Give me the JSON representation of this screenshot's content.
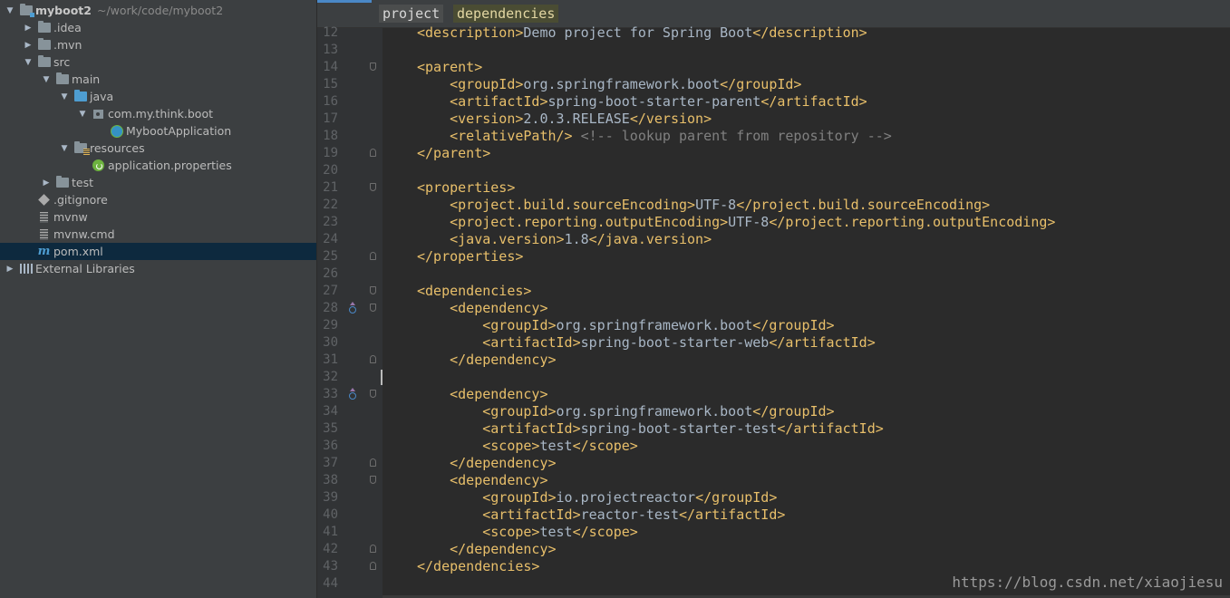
{
  "project": {
    "root": {
      "name": "myboot2",
      "path": "~/work/code/myboot2"
    },
    "tree": [
      {
        "label": "myboot2",
        "depth": 0,
        "arrow": "down",
        "icon": "module-folder",
        "bold": true
      },
      {
        "label": ".idea",
        "depth": 1,
        "arrow": "right",
        "icon": "folder"
      },
      {
        "label": ".mvn",
        "depth": 1,
        "arrow": "right",
        "icon": "folder"
      },
      {
        "label": "src",
        "depth": 1,
        "arrow": "down",
        "icon": "folder"
      },
      {
        "label": "main",
        "depth": 2,
        "arrow": "down",
        "icon": "folder"
      },
      {
        "label": "java",
        "depth": 3,
        "arrow": "down",
        "icon": "source-folder"
      },
      {
        "label": "com.my.think.boot",
        "depth": 4,
        "arrow": "down",
        "icon": "package"
      },
      {
        "label": "MybootApplication",
        "depth": 5,
        "arrow": "none",
        "icon": "spring-class"
      },
      {
        "label": "resources",
        "depth": 3,
        "arrow": "down",
        "icon": "resources-folder"
      },
      {
        "label": "application.properties",
        "depth": 4,
        "arrow": "none",
        "icon": "spring-properties"
      },
      {
        "label": "test",
        "depth": 2,
        "arrow": "right",
        "icon": "folder"
      },
      {
        "label": ".gitignore",
        "depth": 1,
        "arrow": "none",
        "icon": "git-file"
      },
      {
        "label": "mvnw",
        "depth": 1,
        "arrow": "none",
        "icon": "text-file"
      },
      {
        "label": "mvnw.cmd",
        "depth": 1,
        "arrow": "none",
        "icon": "text-file"
      },
      {
        "label": "pom.xml",
        "depth": 1,
        "arrow": "none",
        "icon": "maven-file",
        "selected": true
      },
      {
        "label": "External Libraries",
        "depth": 0,
        "arrow": "right",
        "icon": "libraries"
      }
    ]
  },
  "editor": {
    "breadcrumbs": [
      "project",
      "dependencies"
    ],
    "active_breadcrumb": 1,
    "lines": [
      {
        "n": "12",
        "text": "<description>Demo project for Spring Boot</description>"
      },
      {
        "n": "13",
        "text": ""
      },
      {
        "n": "14",
        "text": "<parent>",
        "fold": "open"
      },
      {
        "n": "15",
        "text": "    <groupId>org.springframework.boot</groupId>"
      },
      {
        "n": "16",
        "text": "    <artifactId>spring-boot-starter-parent</artifactId>"
      },
      {
        "n": "17",
        "text": "    <version>2.0.3.RELEASE</version>"
      },
      {
        "n": "18",
        "text": "    <relativePath/> <!-- lookup parent from repository -->"
      },
      {
        "n": "19",
        "text": "</parent>",
        "fold": "close"
      },
      {
        "n": "20",
        "text": ""
      },
      {
        "n": "21",
        "text": "<properties>",
        "fold": "open"
      },
      {
        "n": "22",
        "text": "    <project.build.sourceEncoding>UTF-8</project.build.sourceEncoding>"
      },
      {
        "n": "23",
        "text": "    <project.reporting.outputEncoding>UTF-8</project.reporting.outputEncoding>"
      },
      {
        "n": "24",
        "text": "    <java.version>1.8</java.version>"
      },
      {
        "n": "25",
        "text": "</properties>",
        "fold": "close"
      },
      {
        "n": "26",
        "text": ""
      },
      {
        "n": "27",
        "text": "<dependencies>",
        "fold": "open"
      },
      {
        "n": "28",
        "text": "    <dependency>",
        "fold": "open",
        "icon": true
      },
      {
        "n": "29",
        "text": "        <groupId>org.springframework.boot</groupId>"
      },
      {
        "n": "30",
        "text": "        <artifactId>spring-boot-starter-web</artifactId>"
      },
      {
        "n": "31",
        "text": "    </dependency>",
        "fold": "close"
      },
      {
        "n": "32",
        "text": "",
        "caret": true
      },
      {
        "n": "33",
        "text": "    <dependency>",
        "fold": "open",
        "icon": true
      },
      {
        "n": "34",
        "text": "        <groupId>org.springframework.boot</groupId>"
      },
      {
        "n": "35",
        "text": "        <artifactId>spring-boot-starter-test</artifactId>"
      },
      {
        "n": "36",
        "text": "        <scope>test</scope>"
      },
      {
        "n": "37",
        "text": "    </dependency>",
        "fold": "close"
      },
      {
        "n": "38",
        "text": "    <dependency>",
        "fold": "open"
      },
      {
        "n": "39",
        "text": "        <groupId>io.projectreactor</groupId>"
      },
      {
        "n": "40",
        "text": "        <artifactId>reactor-test</artifactId>"
      },
      {
        "n": "41",
        "text": "        <scope>test</scope>"
      },
      {
        "n": "42",
        "text": "    </dependency>",
        "fold": "close"
      },
      {
        "n": "43",
        "text": "</dependencies>",
        "fold": "close"
      },
      {
        "n": "44",
        "text": ""
      }
    ]
  },
  "watermark": "https://blog.csdn.net/xiaojiesu",
  "colors": {
    "tag": "#e8bf6a",
    "text": "#a9b7c6",
    "comment": "#808080",
    "line_number": "#606366",
    "selection": "#0d293e"
  }
}
